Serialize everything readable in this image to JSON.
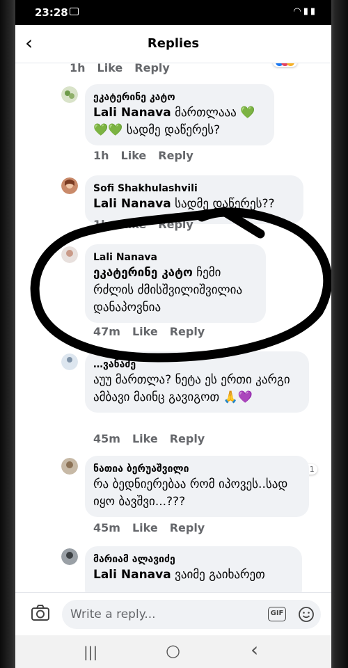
{
  "status_bar": {
    "time": "23:28",
    "icons": [
      "image-icon",
      "wifi-icon",
      "signal-icon",
      "battery-icon"
    ]
  },
  "header": {
    "title": "Replies",
    "back_icon": "chevron-left-icon"
  },
  "top_actions": {
    "time": "1h",
    "like": "Like",
    "reply": "Reply"
  },
  "comments": [
    {
      "author": "ეკატერინე კატო",
      "mention": "Lali Nanava",
      "text": " მართლააა 💚💚💚 სადმე დაწერეს?",
      "time": "1h",
      "like": "Like",
      "reply": "Reply"
    },
    {
      "author": "Sofi Shakhulashvili",
      "mention": "Lali Nanava",
      "text": " სადმე დაწერეს??",
      "time": "1h",
      "like": "Like",
      "reply": "Reply"
    },
    {
      "author": "Lali Nanava",
      "mention": "ეკატერინე კატო",
      "text": " ჩემი რძლის ძმისშვილიშვილია დანაპოვნია",
      "time": "47m",
      "like": "Like",
      "reply": "Reply"
    },
    {
      "author": "…ვანაძე",
      "text": "აუუ მართლა? ნეტა ეს ერთი კარგი ამბავი მაინც გავიგოთ 🙏💜",
      "time": "45m",
      "like": "Like",
      "reply": "Reply",
      "reaction_count": "1"
    },
    {
      "author": "ნათია ბერუაშვილი",
      "text": "რა ბედნიერებაა რომ იპოვეს..სად იყო ბავშვი...???",
      "time": "45m",
      "like": "Like",
      "reply": "Reply"
    },
    {
      "author": "მარიამ ალავიძე",
      "mention": "Lali Nanava",
      "text": " ვაიმე გაიხარეთ"
    }
  ],
  "composer": {
    "placeholder": "Write a reply...",
    "gif_label": "GIF"
  },
  "nav": {
    "recents": "|||",
    "home": "○",
    "back": "‹"
  },
  "colors": {
    "annotation": "#000000",
    "bubble": "#f0f2f5",
    "meta_text": "#65676b"
  }
}
